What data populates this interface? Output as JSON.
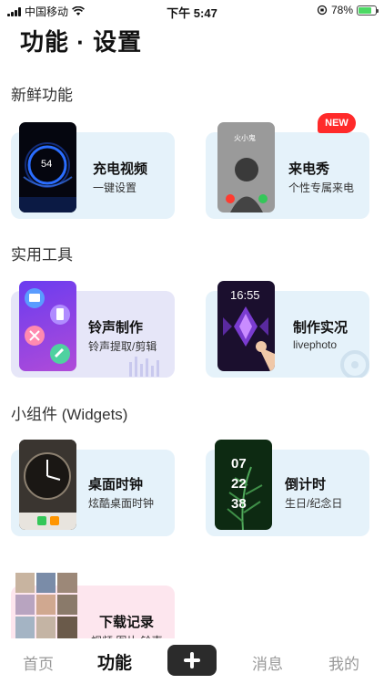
{
  "status_bar": {
    "carrier": "中国移动",
    "time": "下午 5:47",
    "battery": "78%",
    "battery_level": 0.78
  },
  "page_title": "功能 · 设置",
  "sections": [
    {
      "title": "新鲜功能"
    },
    {
      "title": "实用工具"
    },
    {
      "title": "小组件 (Widgets)"
    }
  ],
  "cards": {
    "charge_video": {
      "title": "充电视频",
      "subtitle": "一键设置",
      "thumb_text": "54"
    },
    "call_show": {
      "title": "来电秀",
      "subtitle": "个性专属来电",
      "badge": "NEW",
      "thumb_name": "火小鬼"
    },
    "ringtone": {
      "title": "铃声制作",
      "subtitle": "铃声提取/剪辑"
    },
    "live_photo": {
      "title": "制作实况",
      "subtitle": "livephoto",
      "thumb_time": "16:55"
    },
    "desk_clock": {
      "title": "桌面时钟",
      "subtitle": "炫酷桌面时钟"
    },
    "countdown": {
      "title": "倒计时",
      "subtitle": "生日/纪念日",
      "thumb_lines": [
        "07",
        "22",
        "38"
      ]
    },
    "downloads": {
      "title": "下载记录",
      "subtitle": "视频 图片 铃声"
    }
  },
  "tabbar": {
    "items": [
      "首页",
      "功能",
      "消息",
      "我的"
    ],
    "active": "功能"
  },
  "colors": {
    "card_blue": "#e5f2fa",
    "card_purple": "#e6e6f8",
    "card_pink": "#fde6ee",
    "badge_red": "#ff2a2a"
  }
}
